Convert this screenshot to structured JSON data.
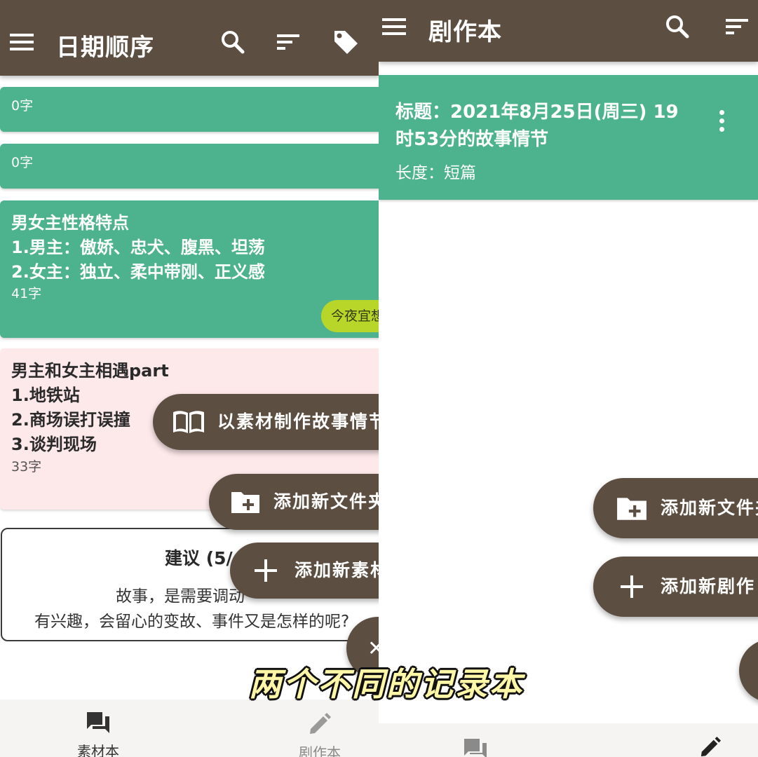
{
  "left": {
    "appbar": {
      "title": "日期顺序",
      "icons": [
        "menu-icon",
        "search-icon",
        "sort-icon",
        "tag-icon"
      ]
    },
    "cards": [
      {
        "count": "0字"
      },
      {
        "count": "0字"
      },
      {
        "title": "男女主性格特点",
        "lines": [
          "1.男主：傲娇、忠犬、腹黑、坦荡",
          "2.女主：独立、柔中带刚、正义感"
        ],
        "count": "41字",
        "tag": "今夜宜想"
      },
      {
        "title": "男主和女主相遇part",
        "lines": [
          "1.地铁站",
          "2.商场误打误撞",
          "3.谈判现场"
        ],
        "count": "33字"
      }
    ],
    "suggestion": {
      "title": "建议 (5/",
      "text1": "故事，是需要调动",
      "text2": "有兴趣，会留心的变故、事件又是怎样的呢?"
    },
    "fabs": {
      "make_story": "以素材制作故事情节",
      "add_folder": "添加新文件夹",
      "add_material": "添加新素材"
    },
    "bottom_nav": [
      {
        "label": "素材本",
        "icon": "forum-icon"
      },
      {
        "label": "剧作本",
        "icon": "pencil-icon"
      }
    ]
  },
  "right": {
    "appbar": {
      "title": "剧作本",
      "icons": [
        "menu-icon",
        "search-icon",
        "sort-icon"
      ]
    },
    "card": {
      "title_line1": "标题：2021年8月25日(周三) 19",
      "title_line2": "时53分的故事情节",
      "length": "长度：短篇"
    },
    "fabs": {
      "add_folder": "添加新文件夹",
      "add_script": "添加新剧作"
    }
  },
  "subtitle": "两个不同的记录本",
  "colors": {
    "appbar": "#5c4f42",
    "card_green": "#4db38e",
    "card_pink": "#fde8ea",
    "tag_chip": "#b8d62a",
    "subtitle": "#fff7a8"
  }
}
